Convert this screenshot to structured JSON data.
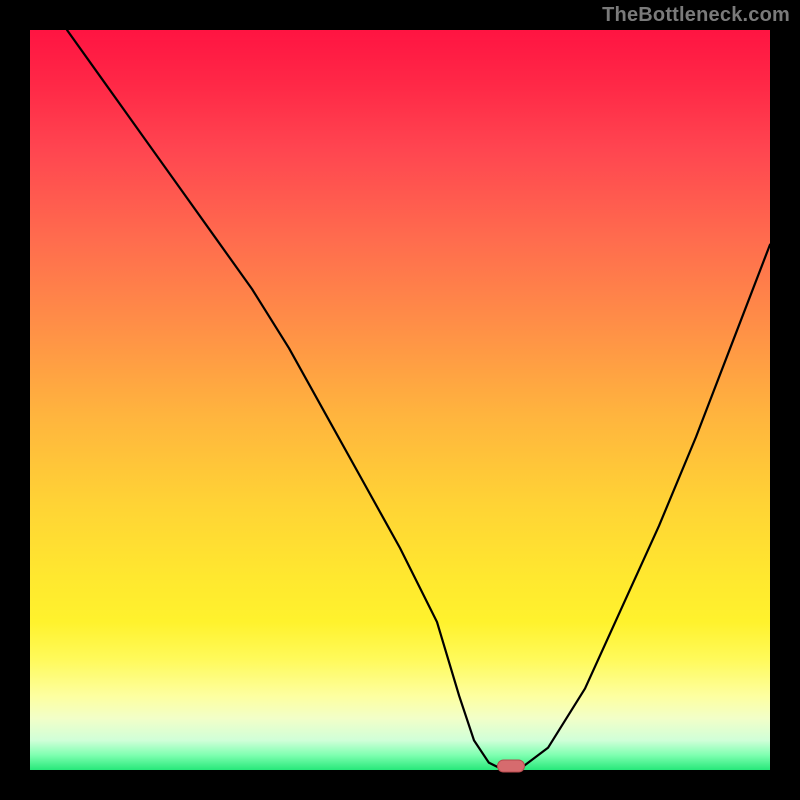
{
  "watermark": "TheBottleneck.com",
  "chart_data": {
    "type": "line",
    "title": "",
    "xlabel": "",
    "ylabel": "",
    "xlim": [
      0,
      100
    ],
    "ylim": [
      0,
      100
    ],
    "grid": false,
    "series": [
      {
        "name": "bottleneck-curve",
        "x": [
          5,
          10,
          15,
          20,
          25,
          30,
          35,
          40,
          45,
          50,
          55,
          58,
          60,
          62,
          64,
          66,
          70,
          75,
          80,
          85,
          90,
          95,
          100
        ],
        "values": [
          100,
          93,
          86,
          79,
          72,
          65,
          57,
          48,
          39,
          30,
          20,
          10,
          4,
          1,
          0,
          0,
          3,
          11,
          22,
          33,
          45,
          58,
          71
        ]
      }
    ],
    "marker": {
      "x": 65,
      "y": 0.5
    },
    "background_gradient": {
      "top_color": "#ff1442",
      "mid_color": "#ffe82f",
      "bottom_color": "#27e87a"
    }
  }
}
